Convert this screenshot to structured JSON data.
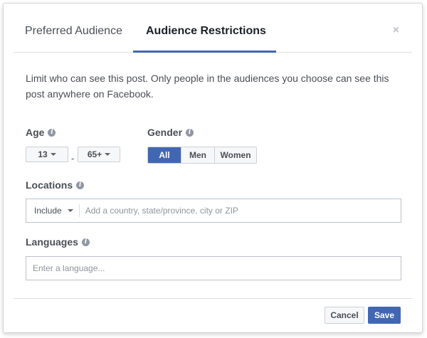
{
  "tabs": [
    {
      "label": "Preferred Audience",
      "active": false
    },
    {
      "label": "Audience Restrictions",
      "active": true
    }
  ],
  "close_label": "×",
  "description": "Limit who can see this post. Only people in the audiences you choose can see this post anywhere on Facebook.",
  "age": {
    "label": "Age",
    "min": "13",
    "separator": "-",
    "max": "65+"
  },
  "gender": {
    "label": "Gender",
    "options": [
      "All",
      "Men",
      "Women"
    ],
    "selected": "All"
  },
  "locations": {
    "label": "Locations",
    "include_value": "Include",
    "placeholder": "Add a country, state/province, city or ZIP"
  },
  "languages": {
    "label": "Languages",
    "placeholder": "Enter a language..."
  },
  "footer": {
    "cancel_label": "Cancel",
    "save_label": "Save"
  },
  "colors": {
    "accent": "#4267b2",
    "border": "#dddfe2",
    "text": "#4b4f56"
  },
  "icons": {
    "info": "info-icon",
    "dropdown": "caret-down-icon",
    "close": "close-icon"
  }
}
